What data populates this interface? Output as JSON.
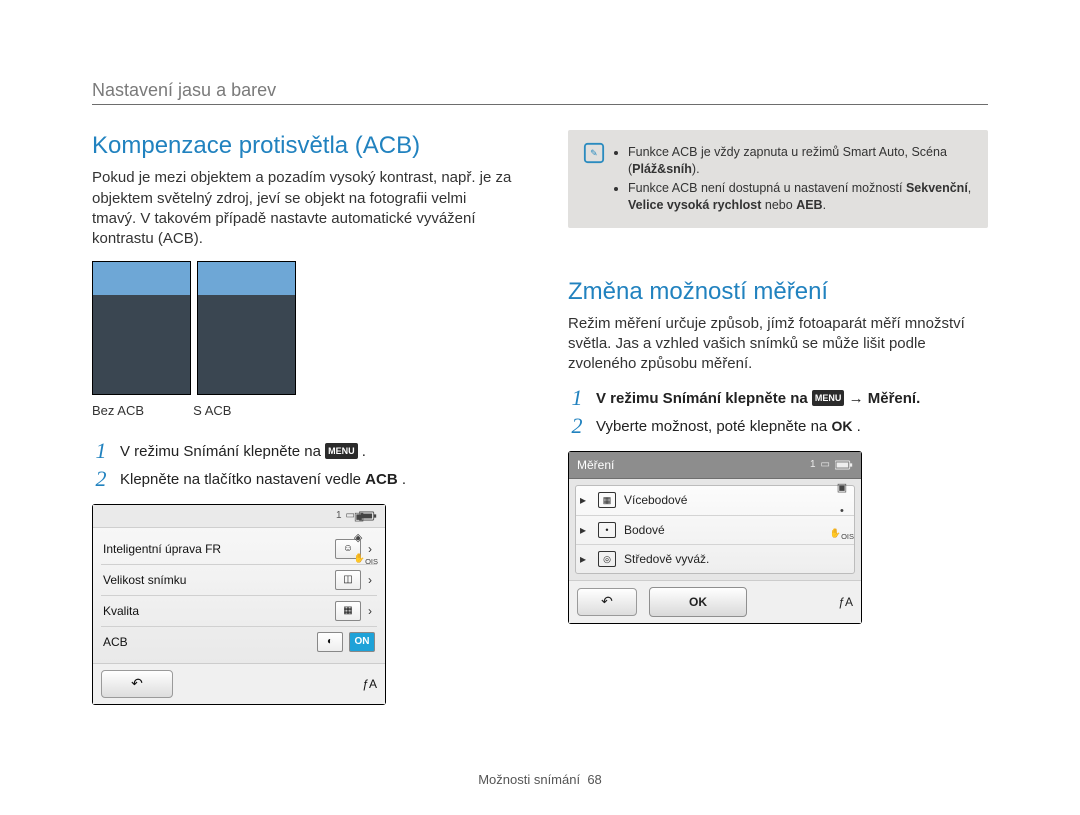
{
  "breadcrumb": "Nastavení jasu a barev",
  "left": {
    "heading": "Kompenzace protisvětla (ACB)",
    "paragraph": "Pokud je mezi objektem a pozadím vysoký kontrast, např. je za objektem světelný zdroj, jeví se objekt na fotografii velmi tmavý. V takovém případě nastavte automatické vyvážení kontrastu (ACB).",
    "caption_left": "Bez ACB",
    "caption_right": "S ACB",
    "step1_pre": "V režimu Snímání klepněte na ",
    "step1_post": ".",
    "step2_pre": "Klepněte na tlačítko nastavení vedle ",
    "step2_bold": "ACB",
    "step2_post": ".",
    "panel": {
      "page_indicator": "1",
      "rows": {
        "r1": "Inteligentní úprava FR",
        "r2": "Velikost snímku",
        "r3": "Kvalita",
        "r4": "ACB"
      },
      "on_label": "ON",
      "flash_indicator": "ƒA"
    }
  },
  "note": {
    "li1_pre": "Funkce ACB je vždy zapnuta u režimů Smart Auto, Scéna (",
    "li1_bold": "Pláž&sníh",
    "li1_post": ").",
    "li2_pre": "Funkce ACB není dostupná u nastavení možností ",
    "li2_b1": "Sekvenční",
    "li2_mid": ", ",
    "li2_b2": "Velice vysoká rychlost",
    "li2_mid2": " nebo ",
    "li2_b3": "AEB",
    "li2_post": "."
  },
  "right": {
    "heading": "Změna možností měření",
    "paragraph": "Režim měření určuje způsob, jímž fotoaparát měří množství světla. Jas a vzhled vašich snímků se může lišit podle zvoleného způsobu měření.",
    "step1_pre": "V režimu Snímání klepněte na ",
    "step1_arrow": " → ",
    "step1_bold": "Měření",
    "step1_post": ".",
    "step2_pre": "Vyberte možnost, poté klepněte na ",
    "step2_ok": "OK",
    "step2_post": ".",
    "panel": {
      "title": "Měření",
      "page_indicator": "1",
      "items": {
        "i1": "Vícebodové",
        "i2": "Bodové",
        "i3": "Středově vyváž."
      },
      "ok": "OK",
      "flash_indicator": "ƒA"
    }
  },
  "menu_chip": "MENU",
  "footer": {
    "section": "Možnosti snímání",
    "page": "68"
  }
}
